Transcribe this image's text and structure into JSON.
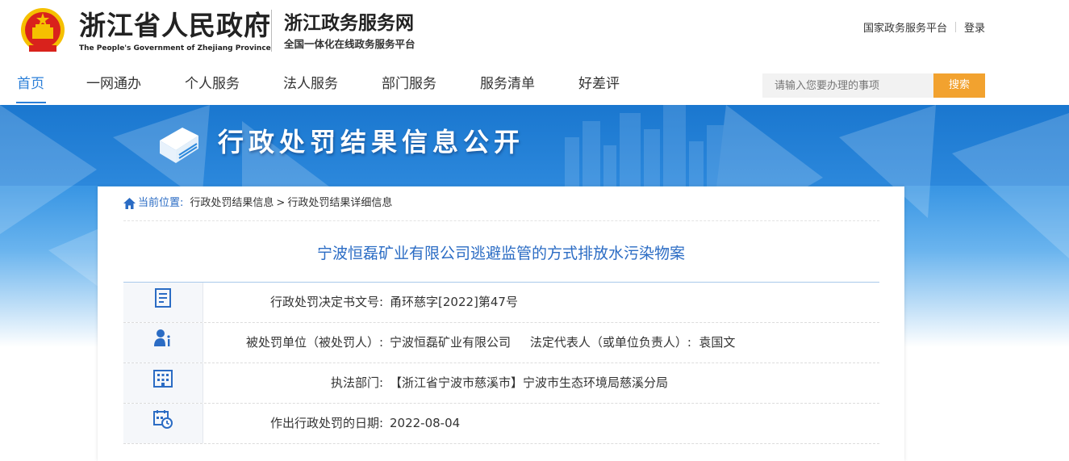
{
  "header": {
    "gov_title": "浙江省人民政府",
    "gov_subtitle": "The People's Government of Zhejiang Province",
    "service_title": "浙江政务服务网",
    "service_subtitle": "全国一体化在线政务服务平台",
    "top_links": [
      "国家政务服务平台",
      "登录"
    ]
  },
  "nav": {
    "items": [
      "首页",
      "一网通办",
      "个人服务",
      "法人服务",
      "部门服务",
      "服务清单",
      "好差评"
    ],
    "active_index": 0,
    "search_placeholder": "请输入您要办理的事项",
    "search_button": "搜索"
  },
  "banner": {
    "title": "行政处罚结果信息公开"
  },
  "breadcrumb": {
    "current_label": "当前位置:",
    "items": [
      "行政处罚结果信息",
      ">",
      "行政处罚结果详细信息"
    ]
  },
  "page_title": "宁波恒磊矿业有限公司逃避监管的方式排放水污染物案",
  "rows": [
    {
      "icon": "document-icon",
      "label": "行政处罚决定书文号:",
      "value": "甬环慈字[2022]第47号"
    },
    {
      "icon": "person-info-icon",
      "label": "被处罚单位（被处罚人）:",
      "value": "宁波恒磊矿业有限公司     法定代表人（或单位负责人）:  袁国文"
    },
    {
      "icon": "building-icon",
      "label": "执法部门:",
      "value": "【浙江省宁波市慈溪市】宁波市生态环境局慈溪分局"
    },
    {
      "icon": "calendar-clock-icon",
      "label": "作出行政处罚的日期:",
      "value": "2022-08-04"
    }
  ],
  "colors": {
    "accent_blue": "#2b7fd8",
    "title_blue": "#2b6cc4",
    "search_orange": "#f2a22f",
    "emblem_red": "#d9221c",
    "emblem_gold": "#f5c000"
  }
}
